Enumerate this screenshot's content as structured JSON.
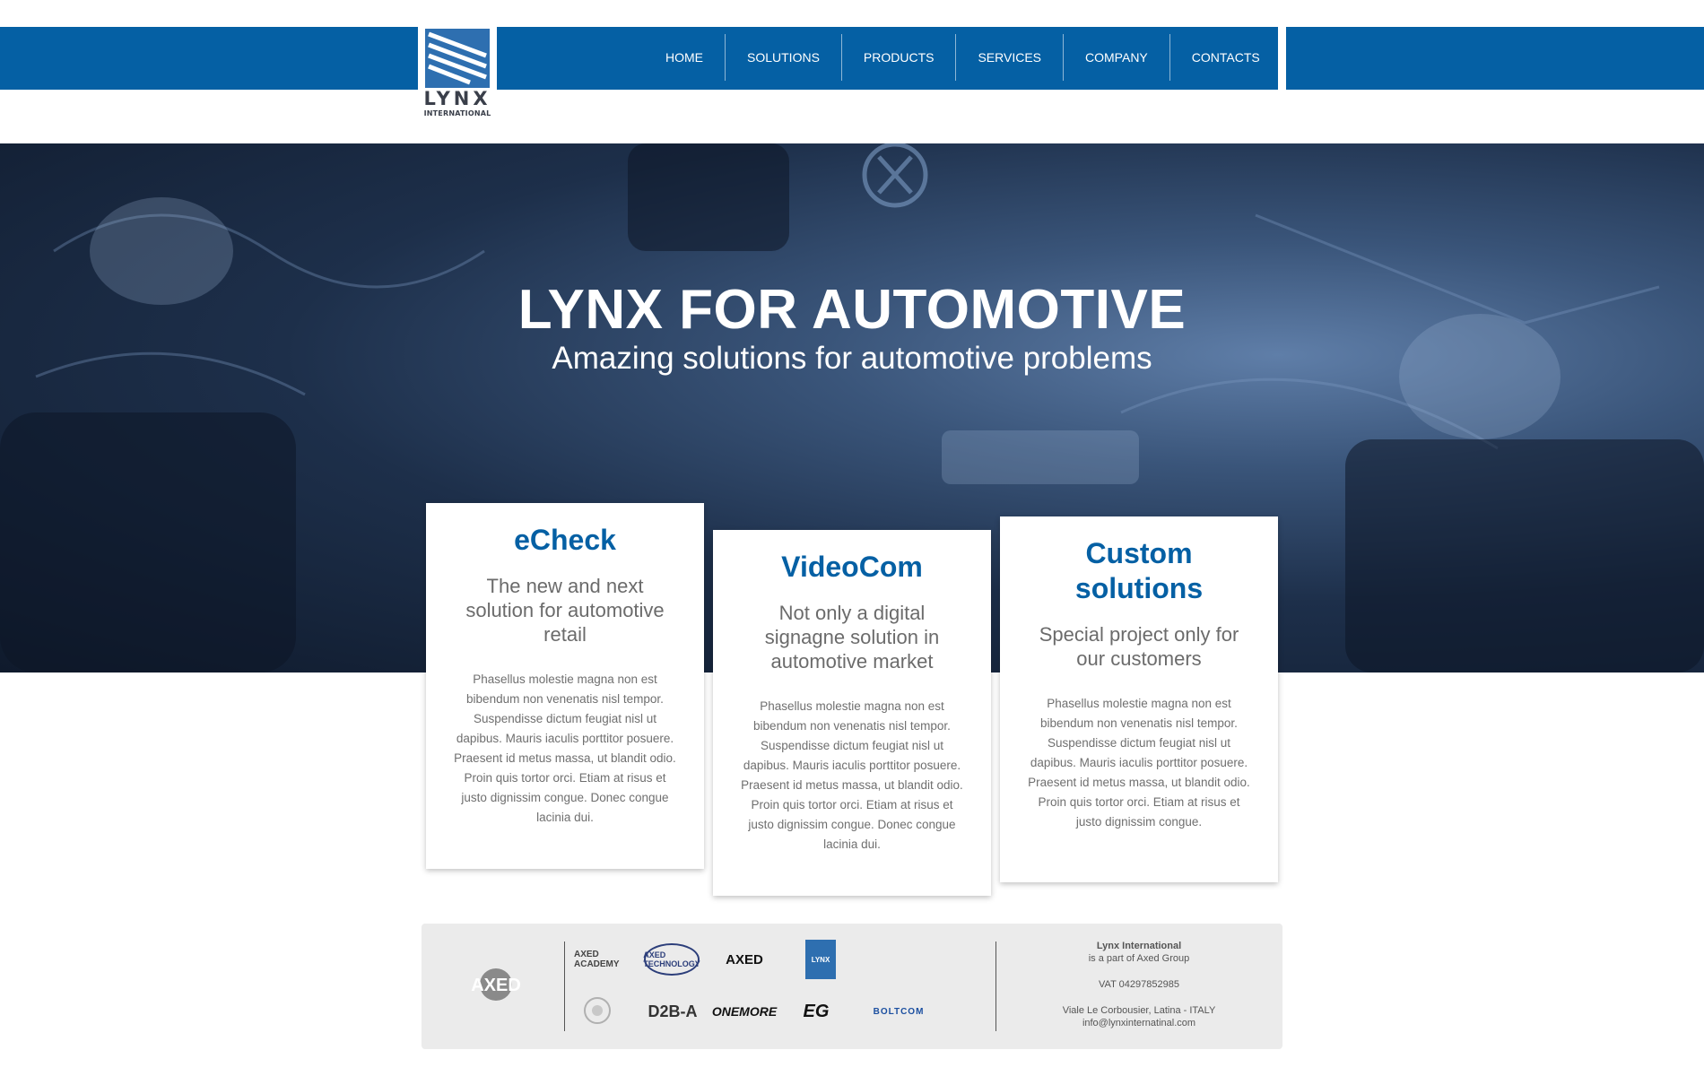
{
  "brand": {
    "name": "LYNX",
    "subtitle": "INTERNATIONAL"
  },
  "nav": [
    {
      "label": "HOME"
    },
    {
      "label": "SOLUTIONS"
    },
    {
      "label": "PRODUCTS"
    },
    {
      "label": "SERVICES"
    },
    {
      "label": "COMPANY"
    },
    {
      "label": "CONTACTS"
    }
  ],
  "hero": {
    "title": "LYNX FOR AUTOMOTIVE",
    "subtitle": "Amazing solutions for automotive problems"
  },
  "cards": [
    {
      "title": "eCheck",
      "lead": "The new and next solution for automotive retail",
      "body": "Phasellus molestie magna non est bibendum non venenatis nisl tempor. Suspendisse dictum feugiat nisl ut dapibus. Mauris iaculis porttitor posuere. Praesent id metus massa, ut blandit odio. Proin quis tortor orci. Etiam at risus et justo dignissim congue. Donec congue lacinia dui."
    },
    {
      "title": "VideoCom",
      "lead": "Not only a digital signagne solution in automotive market",
      "body": "Phasellus molestie magna non est bibendum non venenatis nisl tempor. Suspendisse dictum feugiat nisl ut dapibus. Mauris iaculis porttitor posuere. Praesent id metus massa, ut blandit odio. Proin quis tortor orci. Etiam at risus et justo dignissim congue. Donec congue lacinia dui."
    },
    {
      "title": "Custom solutions",
      "lead": "Special project only for our customers",
      "body": "Phasellus molestie magna non est bibendum non venenatis nisl tempor. Suspendisse dictum feugiat nisl ut dapibus. Mauris iaculis porttitor posuere. Praesent id metus massa, ut blandit odio. Proin quis tortor orci. Etiam at risus et justo dignissim congue."
    }
  ],
  "footer": {
    "group_logo": "AXED",
    "partner_logos": [
      "AXED ACADEMY",
      "AXED TECHNOLOGY",
      "AXED",
      "LYNX",
      "D2B-A",
      "ONEMORE",
      "EG",
      "BOLTCOM"
    ],
    "company": "Lynx International",
    "part_of": "is a part of Axed Group",
    "vat": "VAT 04297852985",
    "address": "Viale Le Corbousier, Latina - ITALY",
    "email": "info@lynxinternatinal.com"
  },
  "colors": {
    "brand_blue": "#0560a4",
    "footer_bg": "#ebebeb"
  }
}
